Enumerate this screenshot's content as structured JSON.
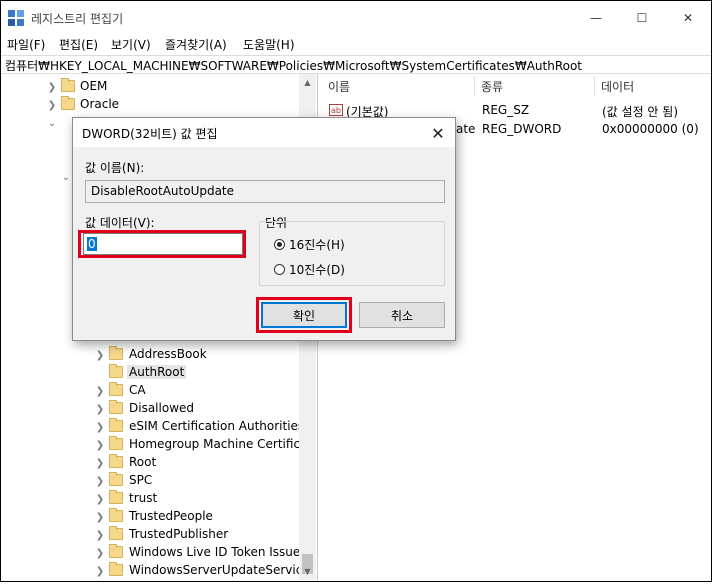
{
  "window": {
    "title": "레지스트리 편집기",
    "min_glyph": "—",
    "max_glyph": "☐",
    "close_glyph": "✕"
  },
  "menu": [
    "파일(F)",
    "편집(E)",
    "보기(V)",
    "즐겨찾기(A)",
    "도움말(H)"
  ],
  "address": "컴퓨터₩HKEY_LOCAL_MACHINE₩SOFTWARE₩Policies₩Microsoft₩SystemCertificates₩AuthRoot",
  "tree_top": [
    {
      "label": "OEM"
    },
    {
      "label": "Oracle"
    }
  ],
  "tree_bottom": [
    {
      "label": "AddressBook"
    },
    {
      "label": "AuthRoot",
      "selected": true
    },
    {
      "label": "CA"
    },
    {
      "label": "Disallowed"
    },
    {
      "label": "eSIM Certification Authorities"
    },
    {
      "label": "Homegroup Machine Certificates"
    },
    {
      "label": "Root"
    },
    {
      "label": "SPC"
    },
    {
      "label": "trust"
    },
    {
      "label": "TrustedPeople"
    },
    {
      "label": "TrustedPublisher"
    },
    {
      "label": "Windows Live ID Token Issuer"
    },
    {
      "label": "WindowsServerUpdateServices"
    }
  ],
  "list": {
    "columns": [
      "이름",
      "종류",
      "데이터"
    ],
    "rows": [
      {
        "name": "(기본값)",
        "type": "REG_SZ",
        "data": "(값 설정 안 됨)"
      },
      {
        "name": "DisableRootAutoUpdate",
        "name_visible": "ate",
        "type": "REG_DWORD",
        "data": "0x00000000 (0)"
      }
    ]
  },
  "dialog": {
    "title": "DWORD(32비트) 값 편집",
    "close_glyph": "✕",
    "value_name_label": "값 이름(N):",
    "value_name": "DisableRootAutoUpdate",
    "value_data_label": "값 데이터(V):",
    "value_data": "0",
    "base_label": "단위",
    "hex_label": "16진수(H)",
    "dec_label": "10진수(D)",
    "base_selected": "hex",
    "ok_label": "확인",
    "cancel_label": "취소"
  },
  "colors": {
    "highlight": "#e0001b",
    "selection": "#0078d7",
    "folder": "#f5d98b"
  }
}
